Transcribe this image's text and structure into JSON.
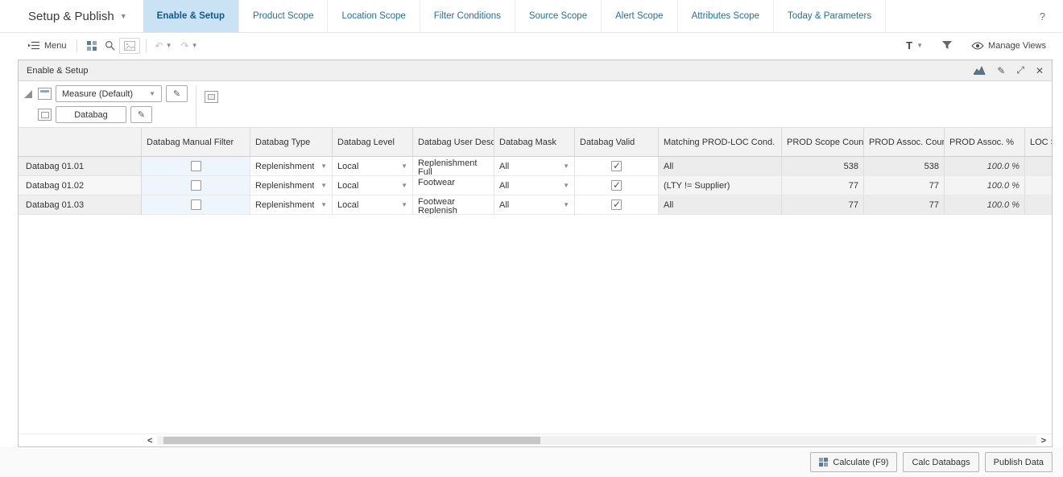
{
  "colors": {
    "accent_blue": "#1f6fa7",
    "active_tab_bg": "#c9e3f5"
  },
  "app": {
    "title": "Setup & Publish",
    "help": "?",
    "tabs": [
      {
        "label": "Enable & Setup",
        "active": true
      },
      {
        "label": "Product Scope",
        "active": false
      },
      {
        "label": "Location Scope",
        "active": false
      },
      {
        "label": "Filter Conditions",
        "active": false
      },
      {
        "label": "Source Scope",
        "active": false
      },
      {
        "label": "Alert Scope",
        "active": false
      },
      {
        "label": "Attributes Scope",
        "active": false
      },
      {
        "label": "Today & Parameters",
        "active": false
      }
    ]
  },
  "toolbar": {
    "menu_label": "Menu",
    "manage_views_label": "Manage Views",
    "format_icon_letter": "T"
  },
  "panel": {
    "title": "Enable & Setup",
    "measure_selector_label": "Measure (Default)",
    "dimension_label": "Databag"
  },
  "grid": {
    "columns": [
      "Databag Manual Filter",
      "Databag Type",
      "Databag Level",
      "Databag User Descr.",
      "Databag Mask",
      "Databag Valid",
      "Matching PROD-LOC Cond.",
      "PROD Scope Count",
      "PROD Assoc. Count",
      "PROD Assoc. %",
      "LOC Sc"
    ],
    "rows": [
      {
        "name": "Databag 01.01",
        "manual_filter": false,
        "type": "Replenishment",
        "level": "Local",
        "user_descr": "Replenishment Full",
        "mask": "All",
        "valid": true,
        "matching_cond": "All",
        "prod_scope_count": "538",
        "prod_assoc_count": "538",
        "prod_assoc_pct": "100.0 %",
        "loc_scope": ""
      },
      {
        "name": "Databag 01.02",
        "manual_filter": false,
        "type": "Replenishment",
        "level": "Local",
        "user_descr": "Footwear",
        "mask": "All",
        "valid": true,
        "matching_cond": "(LTY != Supplier)",
        "prod_scope_count": "77",
        "prod_assoc_count": "77",
        "prod_assoc_pct": "100.0 %",
        "loc_scope": ""
      },
      {
        "name": "Databag 01.03",
        "manual_filter": false,
        "type": "Replenishment",
        "level": "Local",
        "user_descr": "Footwear Replenish",
        "mask": "All",
        "valid": true,
        "matching_cond": "All",
        "prod_scope_count": "77",
        "prod_assoc_count": "77",
        "prod_assoc_pct": "100.0 %",
        "loc_scope": ""
      }
    ]
  },
  "footer": {
    "calculate_label": "Calculate (F9)",
    "calc_databags_label": "Calc Databags",
    "publish_label": "Publish Data"
  }
}
